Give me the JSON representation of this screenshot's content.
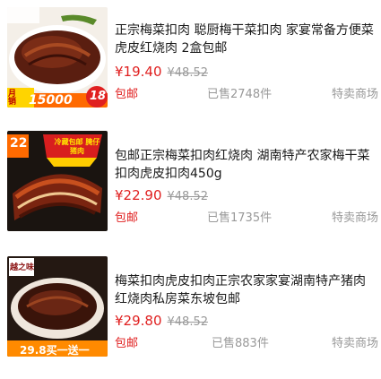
{
  "items": [
    {
      "title": "正宗梅菜扣肉 聪厨梅干菜扣肉 家宴常备方便菜虎皮红烧肉 2盒包邮",
      "price": "¥19.40",
      "original_price": "¥48.52",
      "shipping": "包邮",
      "sold": "已售2748件",
      "shop": "特卖商场",
      "image_badge": {
        "left": "月销",
        "count": "15000",
        "right_num": "18"
      }
    },
    {
      "title": "包邮正宗梅菜扣肉红烧肉 湖南特产农家梅干菜扣肉虎皮扣肉450g",
      "price": "¥22.90",
      "original_price": "¥48.52",
      "shipping": "包邮",
      "sold": "已售1735件",
      "shop": "特卖商场",
      "image_badge": {
        "top_left": "22",
        "ribbon": "冷藏包邮 腌仔猪肉"
      }
    },
    {
      "title": "梅菜扣肉虎皮扣肉正宗农家家宴湖南特产猪肉红烧肉私房菜东坡包邮",
      "price": "¥29.80",
      "original_price": "¥48.52",
      "shipping": "包邮",
      "sold": "已售883件",
      "shop": "特卖商场",
      "image_badge": {
        "bottom": "29.8买一送一",
        "logo": "越之味"
      }
    }
  ],
  "colors": {
    "price": "#e02020",
    "muted": "#999999",
    "accent_orange": "#ff6a00"
  }
}
